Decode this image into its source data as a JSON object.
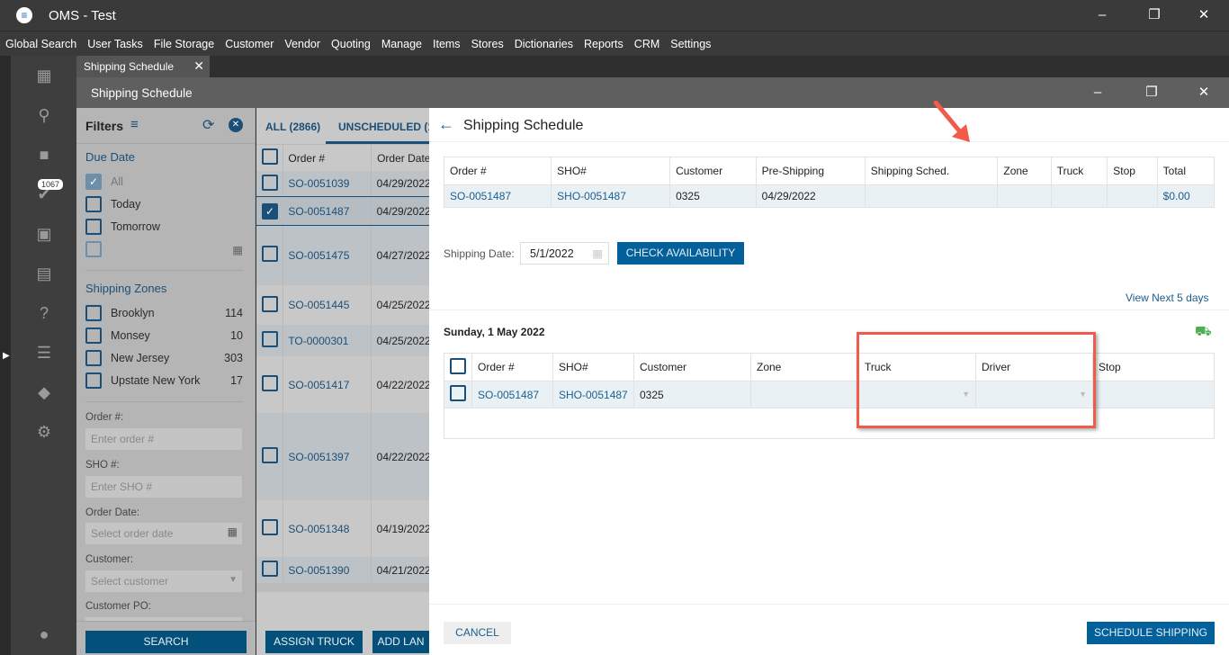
{
  "app": {
    "title": "OMS - Test",
    "logo": "E"
  },
  "menu": [
    "Global Search",
    "User Tasks",
    "File Storage",
    "Customer",
    "Vendor",
    "Quoting",
    "Manage",
    "Items",
    "Stores",
    "Dictionaries",
    "Reports",
    "CRM",
    "Settings"
  ],
  "rail": {
    "badge": "1067",
    "icons": [
      "dashboard-icon",
      "search-icon",
      "folder-icon",
      "tasks-icon",
      "contact-icon",
      "store-icon",
      "question-clipboard-icon",
      "clipboard-icon",
      "tag-icon",
      "gear-icon",
      "user-icon"
    ]
  },
  "tab": {
    "label": "Shipping Schedule"
  },
  "window": {
    "title": "Shipping Schedule"
  },
  "filters": {
    "title": "Filters",
    "due_date": "Due Date",
    "due_items": [
      {
        "label": "All",
        "checked": true
      },
      {
        "label": "Today"
      },
      {
        "label": "Tomorrow"
      }
    ],
    "zones_title": "Shipping Zones",
    "zones": [
      {
        "label": "Brooklyn",
        "count": "114"
      },
      {
        "label": "Monsey",
        "count": "10"
      },
      {
        "label": "New Jersey",
        "count": "303"
      },
      {
        "label": "Upstate New York",
        "count": "17"
      }
    ],
    "order_label": "Order #:",
    "order_ph": "Enter order #",
    "sho_label": "SHO #:",
    "sho_ph": "Enter SHO #",
    "date_label": "Order Date:",
    "date_ph": "Select order date",
    "cust_label": "Customer:",
    "cust_ph": "Select customer",
    "po_label": "Customer PO:",
    "search": "SEARCH"
  },
  "list": {
    "tab_all": "ALL (2866)",
    "tab_unsched": "UNSCHEDULED (1",
    "col_order": "Order #",
    "col_date": "Order Date",
    "rows": [
      {
        "o": "SO-0051039",
        "d": "04/29/2022"
      },
      {
        "o": "SO-0051487",
        "d": "04/29/2022",
        "checked": true
      },
      {
        "o": "SO-0051475",
        "d": "04/27/2022"
      },
      {
        "o": "SO-0051445",
        "d": "04/25/2022"
      },
      {
        "o": "TO-0000301",
        "d": "04/25/2022"
      },
      {
        "o": "SO-0051417",
        "d": "04/22/2022"
      },
      {
        "o": "SO-0051397",
        "d": "04/22/2022"
      },
      {
        "o": "SO-0051348",
        "d": "04/19/2022"
      },
      {
        "o": "SO-0051390",
        "d": "04/21/2022"
      }
    ],
    "assign": "ASSIGN TRUCK",
    "add": "ADD LAN"
  },
  "dialog": {
    "title": "Shipping Schedule",
    "summary_cols": [
      "Order #",
      "SHO#",
      "Customer",
      "Pre-Shipping",
      "Shipping Sched.",
      "Zone",
      "Truck",
      "Stop",
      "Total"
    ],
    "summary_row": [
      "SO-0051487",
      "SHO-0051487",
      "0325",
      "04/29/2022",
      "",
      "",
      "",
      "",
      "$0.00"
    ],
    "ship_date_label": "Shipping Date:",
    "ship_date": "5/1/2022",
    "check": "CHECK AVAILABILITY",
    "next": "View Next 5 days",
    "day_title": "Sunday, 1 May 2022",
    "day_cols": [
      "Order #",
      "SHO#",
      "Customer",
      "Zone",
      "Truck",
      "Driver",
      "Stop"
    ],
    "day_row": [
      "SO-0051487",
      "SHO-0051487",
      "0325",
      "",
      "",
      "",
      ""
    ],
    "cancel": "CANCEL",
    "schedule": "SCHEDULE SHIPPING"
  },
  "colors": {
    "accent": "#03507a",
    "link": "#1b5e8f",
    "highlight": "#f25a4a",
    "truck_ok": "#4caf50"
  }
}
